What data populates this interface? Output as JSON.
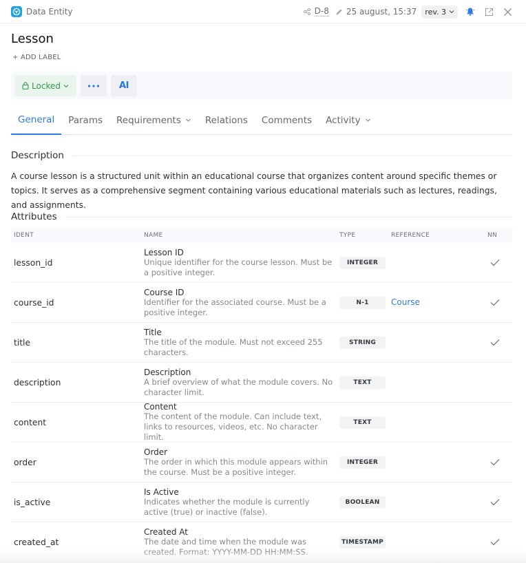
{
  "header": {
    "entity_type": "Data Entity",
    "entity_icon": "cube-icon",
    "doc_id": "D-8",
    "timestamp": "25 august, 15:37",
    "revision": "rev. 3",
    "icons": [
      "share-icon",
      "pencil-icon",
      "chevron-down-icon",
      "bell-icon",
      "external-link-icon",
      "close-icon"
    ],
    "accent_color": "#21a4dd"
  },
  "page": {
    "title": "Lesson",
    "add_label": "+ ADD LABEL"
  },
  "toolbar": {
    "lock_label": "Locked",
    "lock_color": "#2e9b4b",
    "more_icon": "more-horizontal-icon",
    "ai_label": "AI"
  },
  "tabs": [
    {
      "label": "General",
      "active": true,
      "has_dropdown": false
    },
    {
      "label": "Params",
      "active": false,
      "has_dropdown": false
    },
    {
      "label": "Requirements",
      "active": false,
      "has_dropdown": true
    },
    {
      "label": "Relations",
      "active": false,
      "has_dropdown": false
    },
    {
      "label": "Comments",
      "active": false,
      "has_dropdown": false
    },
    {
      "label": "Activity",
      "active": false,
      "has_dropdown": true
    }
  ],
  "description": {
    "heading": "Description",
    "text": "A course lesson is a structured unit within an educational course that organizes content around specific themes or topics. It serves as a comprehensive segment containing various educational materials such as lectures, readings, and assignments."
  },
  "attributes": {
    "heading": "Attributes",
    "columns": {
      "ident": "IDENT",
      "name": "NAME",
      "type": "TYPE",
      "reference": "REFERENCE",
      "nn": "NN"
    },
    "rows": [
      {
        "ident": "lesson_id",
        "name": "Lesson ID",
        "desc": "Unique identifier for the course lesson. Must be a positive integer.",
        "type": "INTEGER",
        "reference": "",
        "nn": true
      },
      {
        "ident": "course_id",
        "name": "Course ID",
        "desc": "Identifier for the associated course. Must be a positive integer.",
        "type": "N-1",
        "reference": "Course",
        "nn": true
      },
      {
        "ident": "title",
        "name": "Title",
        "desc": "The title of the module. Must not exceed 255 characters.",
        "type": "STRING",
        "reference": "",
        "nn": true
      },
      {
        "ident": "description",
        "name": "Description",
        "desc": "A brief overview of what the module covers. No character limit.",
        "type": "TEXT",
        "reference": "",
        "nn": false
      },
      {
        "ident": "content",
        "name": "Content",
        "desc": "The content of the module. Can include text, links to resources, videos, etc. No character limit.",
        "type": "TEXT",
        "reference": "",
        "nn": false
      },
      {
        "ident": "order",
        "name": "Order",
        "desc": "The order in which this module appears within the course. Must be a positive integer.",
        "type": "INTEGER",
        "reference": "",
        "nn": true
      },
      {
        "ident": "is_active",
        "name": "Is Active",
        "desc": "Indicates whether the module is currently active (true) or inactive (false).",
        "type": "BOOLEAN",
        "reference": "",
        "nn": true
      },
      {
        "ident": "created_at",
        "name": "Created At",
        "desc": "The date and time when the module was created. Format: YYYY-MM-DD HH:MM:SS.",
        "type": "TIMESTAMP",
        "reference": "",
        "nn": true
      }
    ]
  }
}
